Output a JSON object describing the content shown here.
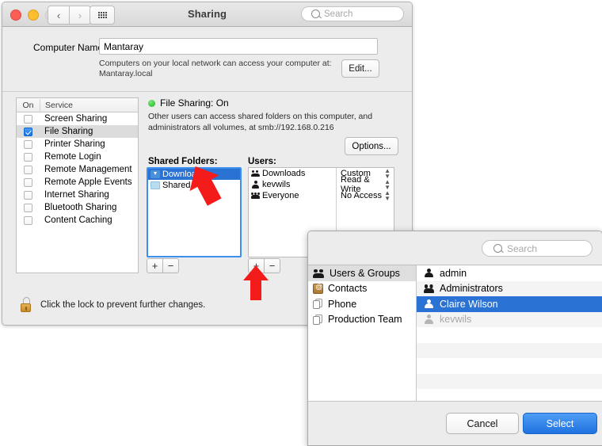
{
  "window": {
    "title": "Sharing",
    "search_placeholder": "Search",
    "nav": {
      "back": "‹",
      "forward": "›"
    },
    "icons": {
      "close": "close-traffic-light",
      "minimize": "minimize-traffic-light",
      "zoom": "zoom-traffic-light",
      "grid": "show-all-grid-icon",
      "search": "search-icon"
    }
  },
  "computer_name": {
    "label": "Computer Name:",
    "value": "Mantaray",
    "note_line1": "Computers on your local network can access your computer at:",
    "note_line2": "Mantaray.local",
    "edit_button": "Edit..."
  },
  "services": {
    "header_on": "On",
    "header_service": "Service",
    "items": [
      {
        "name": "Screen Sharing",
        "checked": false,
        "selected": false
      },
      {
        "name": "File Sharing",
        "checked": true,
        "selected": true
      },
      {
        "name": "Printer Sharing",
        "checked": false,
        "selected": false
      },
      {
        "name": "Remote Login",
        "checked": false,
        "selected": false
      },
      {
        "name": "Remote Management",
        "checked": false,
        "selected": false
      },
      {
        "name": "Remote Apple Events",
        "checked": false,
        "selected": false
      },
      {
        "name": "Internet Sharing",
        "checked": false,
        "selected": false
      },
      {
        "name": "Bluetooth Sharing",
        "checked": false,
        "selected": false
      },
      {
        "name": "Content Caching",
        "checked": false,
        "selected": false
      }
    ]
  },
  "file_sharing": {
    "status": "File Sharing: On",
    "status_color": "#21bd21",
    "description": "Other users can access shared folders on this computer, and administrators all volumes, at smb://192.168.0.216",
    "options_button": "Options..."
  },
  "shared_folders": {
    "label": "Shared Folders:",
    "items": [
      {
        "name": "Downloads",
        "icon": "downloads-folder-icon",
        "selected": true
      },
      {
        "name": "Shared",
        "icon": "folder-icon",
        "selected": false
      }
    ],
    "add_button": "+",
    "remove_button": "−"
  },
  "users": {
    "label": "Users:",
    "rows": [
      {
        "name": "Downloads",
        "icon": "group-icon",
        "permission": "Custom"
      },
      {
        "name": "kevwils",
        "icon": "user-icon",
        "permission": "Read & Write"
      },
      {
        "name": "Everyone",
        "icon": "everyone-icon",
        "permission": "No Access"
      }
    ],
    "add_button": "+",
    "remove_button": "−"
  },
  "lock": {
    "text": "Click the lock to prevent further changes.",
    "icon": "unlocked-padlock-icon"
  },
  "dialog": {
    "search_placeholder": "Search",
    "sidebar": [
      {
        "label": "Users & Groups",
        "icon": "users-groups-icon",
        "selected": true
      },
      {
        "label": "Contacts",
        "icon": "contacts-icon",
        "selected": false
      },
      {
        "label": "Phone",
        "icon": "card-stack-icon",
        "selected": false
      },
      {
        "label": "Production Team",
        "icon": "card-stack-icon",
        "selected": false
      }
    ],
    "list": [
      {
        "label": "admin",
        "icon": "user-icon",
        "selected": false,
        "dimmed": false
      },
      {
        "label": "Administrators",
        "icon": "group-icon",
        "selected": false,
        "dimmed": false
      },
      {
        "label": "Claire Wilson",
        "icon": "user-icon",
        "selected": true,
        "dimmed": false
      },
      {
        "label": "kevwils",
        "icon": "user-icon",
        "selected": false,
        "dimmed": true
      }
    ],
    "cancel_button": "Cancel",
    "select_button": "Select",
    "accent_color": "#2a72d4"
  },
  "annotations": {
    "arrow_color": "#f41b1b",
    "arrow_folder": "points-at-downloads-shared-folder",
    "arrow_plus": "points-at-users-add-button"
  }
}
